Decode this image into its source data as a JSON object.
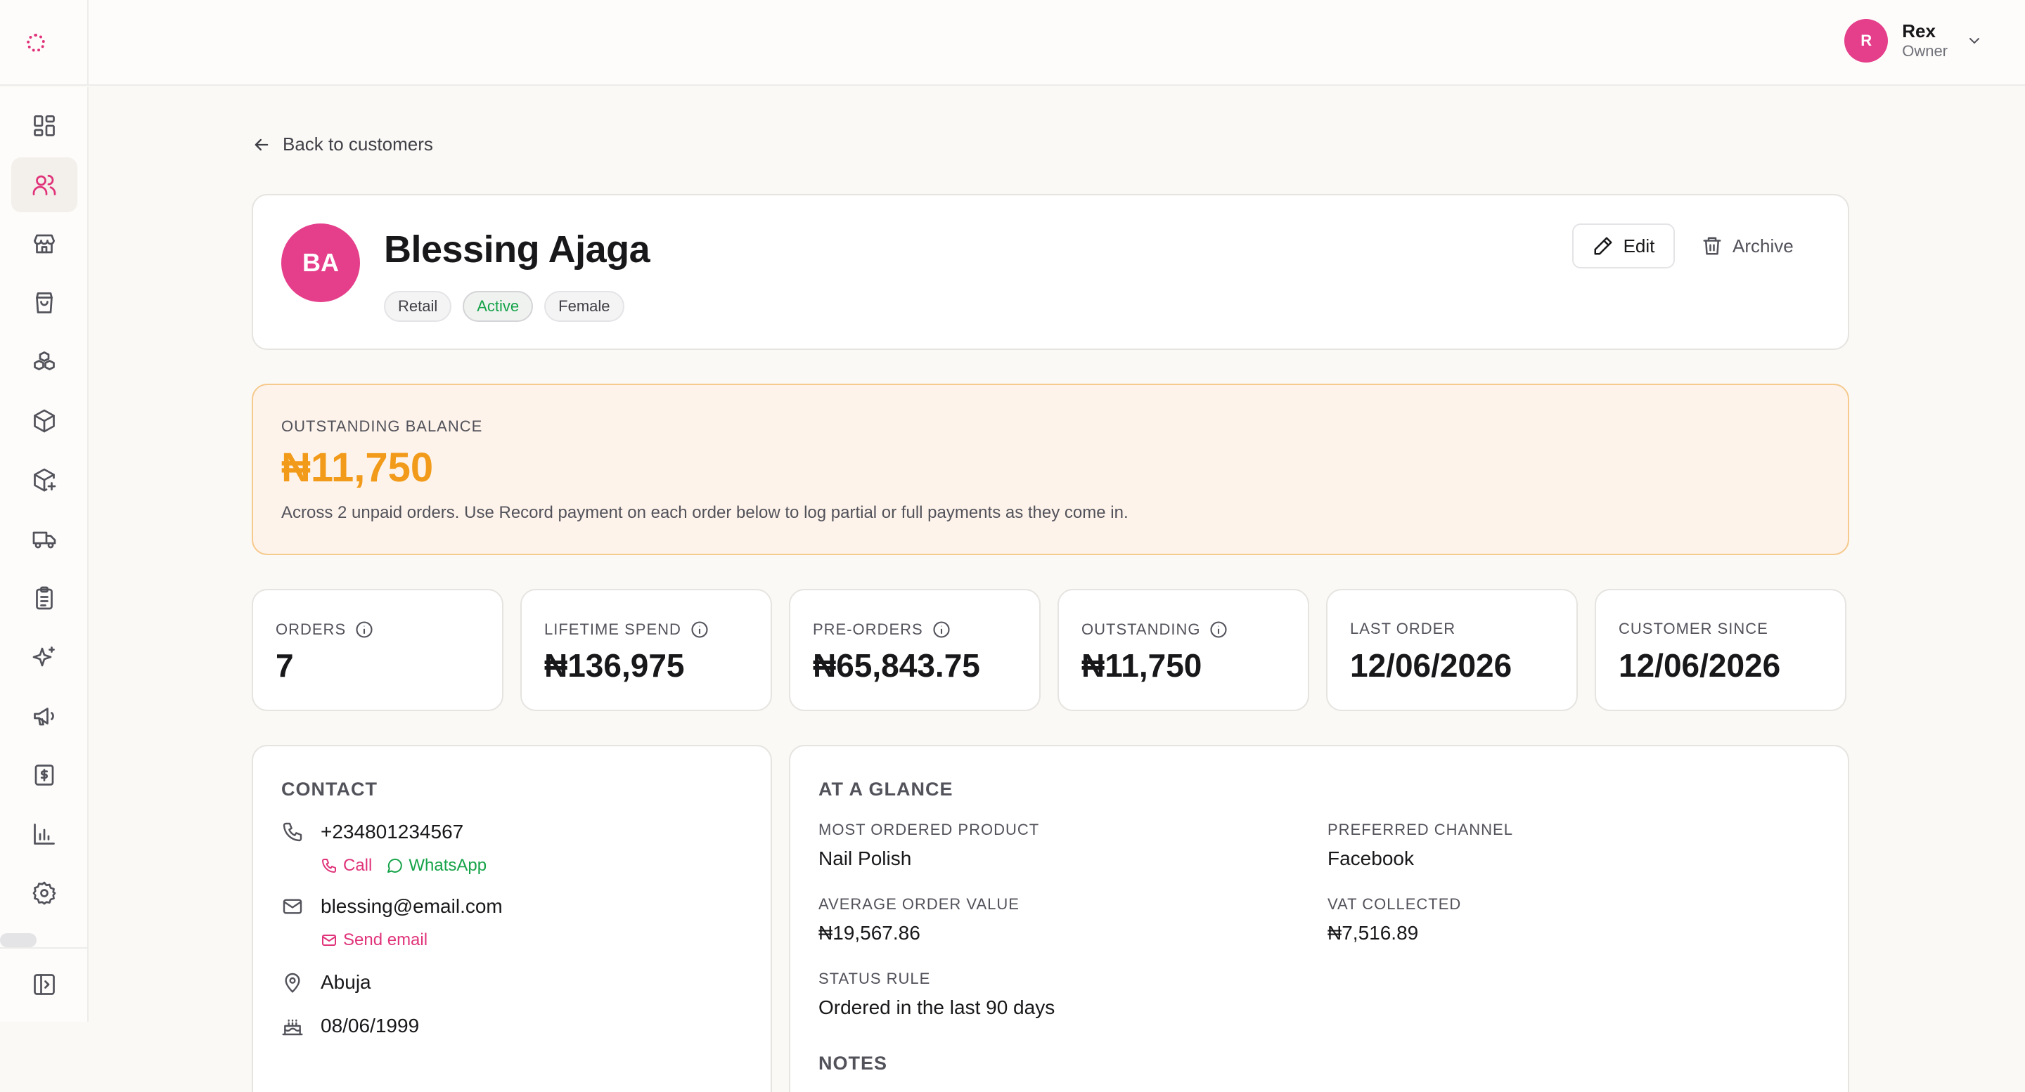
{
  "topbar": {
    "user": {
      "initial": "R",
      "name": "Rex",
      "role": "Owner"
    }
  },
  "sidebar": {
    "items": [
      {
        "icon": "dashboard-icon"
      },
      {
        "icon": "customers-icon",
        "active": true
      },
      {
        "icon": "store-icon"
      },
      {
        "icon": "shopping-bag-icon"
      },
      {
        "icon": "boxes-icon"
      },
      {
        "icon": "package-icon"
      },
      {
        "icon": "package-plus-icon"
      },
      {
        "icon": "truck-icon"
      },
      {
        "icon": "clipboard-list-icon"
      },
      {
        "icon": "sparkles-icon"
      },
      {
        "icon": "megaphone-icon"
      },
      {
        "icon": "dollar-receipt-icon"
      },
      {
        "icon": "bar-chart-icon"
      },
      {
        "icon": "settings-gear-icon"
      }
    ]
  },
  "back_link": "Back to customers",
  "customer": {
    "initials": "BA",
    "name": "Blessing Ajaga",
    "tags": [
      "Retail",
      "Active",
      "Female"
    ],
    "edit_label": "Edit",
    "archive_label": "Archive"
  },
  "balance": {
    "label": "OUTSTANDING BALANCE",
    "value": "₦11,750",
    "note": "Across 2 unpaid orders. Use Record payment on each order below to log partial or full payments as they come in."
  },
  "stats": [
    {
      "label": "ORDERS",
      "value": "7",
      "info": true
    },
    {
      "label": "LIFETIME SPEND",
      "value": "₦136,975",
      "info": true
    },
    {
      "label": "PRE-ORDERS",
      "value": "₦65,843.75",
      "info": true
    },
    {
      "label": "OUTSTANDING",
      "value": "₦11,750",
      "info": true
    },
    {
      "label": "LAST ORDER",
      "value": "12/06/2026",
      "info": false
    },
    {
      "label": "CUSTOMER SINCE",
      "value": "12/06/2026",
      "info": false
    }
  ],
  "contact": {
    "title": "CONTACT",
    "phone": "+234801234567",
    "call_label": "Call",
    "whatsapp_label": "WhatsApp",
    "email": "blessing@email.com",
    "send_email_label": "Send email",
    "location": "Abuja",
    "birthday": "08/06/1999"
  },
  "glance": {
    "title": "AT A GLANCE",
    "most_ordered_label": "MOST ORDERED PRODUCT",
    "most_ordered_value": "Nail Polish",
    "preferred_channel_label": "PREFERRED CHANNEL",
    "preferred_channel_value": "Facebook",
    "avg_order_label": "AVERAGE ORDER VALUE",
    "avg_order_value": "₦19,567.86",
    "vat_label": "VAT COLLECTED",
    "vat_value": "₦7,516.89",
    "status_rule_label": "STATUS RULE",
    "status_rule_value": "Ordered in the last 90 days",
    "notes_title": "NOTES"
  }
}
